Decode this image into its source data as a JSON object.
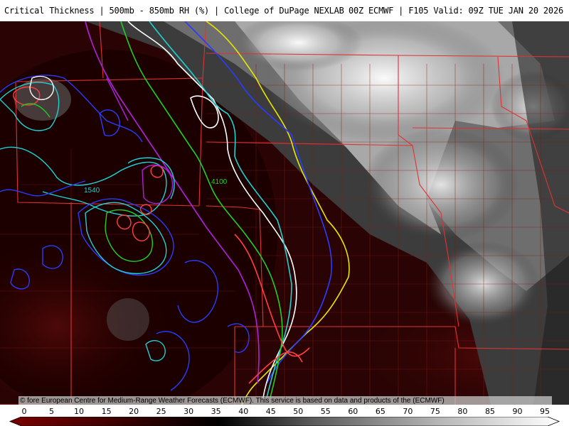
{
  "header": {
    "left": "Critical Thickness | 500mb - 850mb RH (%) | College of DuPage NEXLAB",
    "right": "00Z ECMWF | F105 Valid: 09Z TUE JAN 20 2026"
  },
  "credit": "© fore European Centre for Medium-Range Weather Forecasts (ECMWF). This service is based on data and products of the (ECMWF)",
  "map_labels": {
    "label_1540": "1540",
    "label_4100": "4100"
  },
  "colorbar": {
    "ticks": [
      "0",
      "5",
      "10",
      "15",
      "20",
      "25",
      "30",
      "35",
      "40",
      "45",
      "50",
      "55",
      "60",
      "65",
      "70",
      "75",
      "80",
      "85",
      "90",
      "95"
    ],
    "low_color": "#3a0000",
    "mid_color": "#000000",
    "high_color": "#ffffff"
  },
  "colors": {
    "state_border": "#e03030",
    "county_border": "#a01a1a",
    "contour_yellow": "#e6e600",
    "contour_blue": "#2a3cff",
    "contour_white": "#ffffff",
    "contour_cyan": "#20d0d0",
    "contour_green": "#20d020",
    "contour_purple": "#b020e0",
    "contour_red": "#ff4040"
  }
}
